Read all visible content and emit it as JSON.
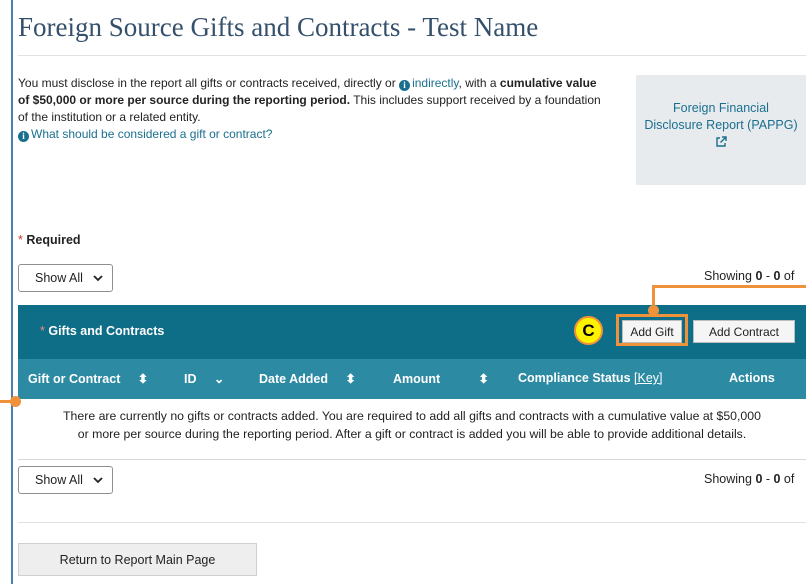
{
  "page": {
    "title": "Foreign Source Gifts and Contracts - Test Name"
  },
  "intro": {
    "line1_a": "You must disclose in the report all gifts or contracts received, directly or ",
    "indirectly_link": "indirectly",
    "line1_b": ", with a ",
    "bold_text": "cumulative value of $50,000 or more per source during the reporting period.",
    "rest": " This includes support received by a foundation of the institution or a related entity.",
    "help_link": "What should be considered a gift or contract?"
  },
  "side_box": {
    "line1": "Foreign Financial",
    "line2": "Disclosure Report (PAPPG)"
  },
  "required_label": "Required",
  "filters": {
    "top_select": "Show All",
    "bottom_select": "Showing",
    "select_value": "Show All"
  },
  "showing": {
    "prefix": "Showing ",
    "from": "0",
    "sep": " - ",
    "to": "0",
    "suffix": " of"
  },
  "panel": {
    "title": "Gifts and Contracts",
    "add_gift": "Add Gift",
    "add_contract": "Add Contract"
  },
  "callout": {
    "label": "C"
  },
  "table": {
    "columns": [
      {
        "label": "Gift or Contract",
        "sort": "⬍"
      },
      {
        "label": "ID",
        "sort": "⌄"
      },
      {
        "label": "Date Added",
        "sort": "⬍"
      },
      {
        "label": "Amount",
        "sort": "⬍"
      },
      {
        "label": "Compliance Status",
        "key_link": "[Key]"
      },
      {
        "label": "Actions"
      }
    ],
    "empty_line1": "There are currently no gifts or contracts added. You are required to add all gifts and contracts with a cumulative value at $50,000",
    "empty_line2": "or more per source during the reporting period. After a gift or contract is added you will be able to provide additional details."
  },
  "footer": {
    "return_button": "Return to Report Main Page"
  },
  "colors": {
    "panel_header": "#0e6d87",
    "column_header": "#2d8aa3",
    "link": "#1a6f8f",
    "annotation": "#f0923a",
    "callout_fill": "#fff200"
  }
}
